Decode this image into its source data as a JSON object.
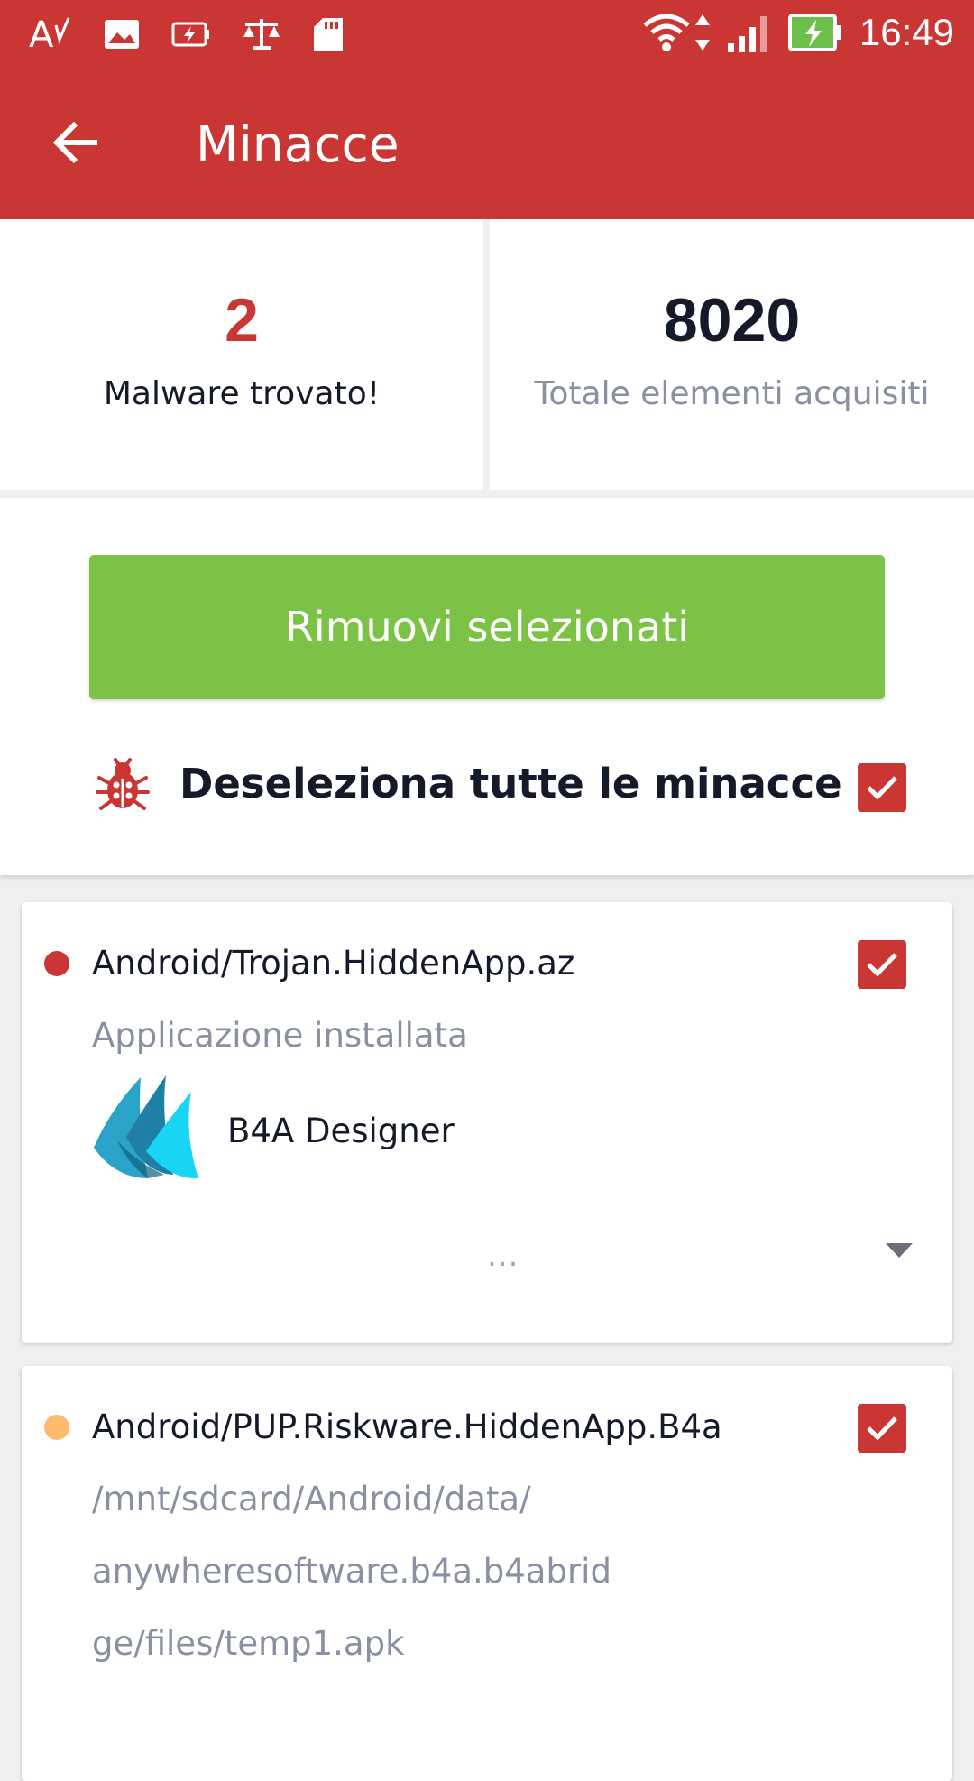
{
  "status_bar": {
    "time": "16:49",
    "icons": [
      "text-format-icon",
      "image-icon",
      "battery-saver-icon",
      "scale-icon",
      "sd-card-icon",
      "wifi-icon",
      "data-arrows-icon",
      "signal-icon",
      "battery-charging-icon"
    ]
  },
  "app_bar": {
    "title": "Minacce",
    "back_icon": "arrow-left-icon"
  },
  "stats": {
    "malware_count": "2",
    "malware_label": "Malware trovato!",
    "total_count": "8020",
    "total_label": "Totale elementi acquisiti"
  },
  "actions": {
    "remove_label": "Rimuovi selezionati",
    "deselect_label": "Deseleziona tutte le minacce",
    "deselect_checked": true
  },
  "threats": [
    {
      "name": "Android/Trojan.HiddenApp.az",
      "type": "Applicazione installata",
      "app_name": "B4A Designer",
      "more": "...",
      "severity_color": "#c93633",
      "checked": true
    },
    {
      "name": "Android/PUP.Riskware.HiddenApp.B4a",
      "path_line_1": "/mnt/sdcard/Android/data/",
      "path_line_2": "anywheresoftware.b4a.b4abrid",
      "path_line_3": "ge/files/temp1.apk",
      "severity_color": "#fbbd6b",
      "checked": true
    }
  ],
  "colors": {
    "brand_red": "#c93633",
    "action_green": "#7cc247",
    "warning_orange": "#fbbd6b"
  }
}
